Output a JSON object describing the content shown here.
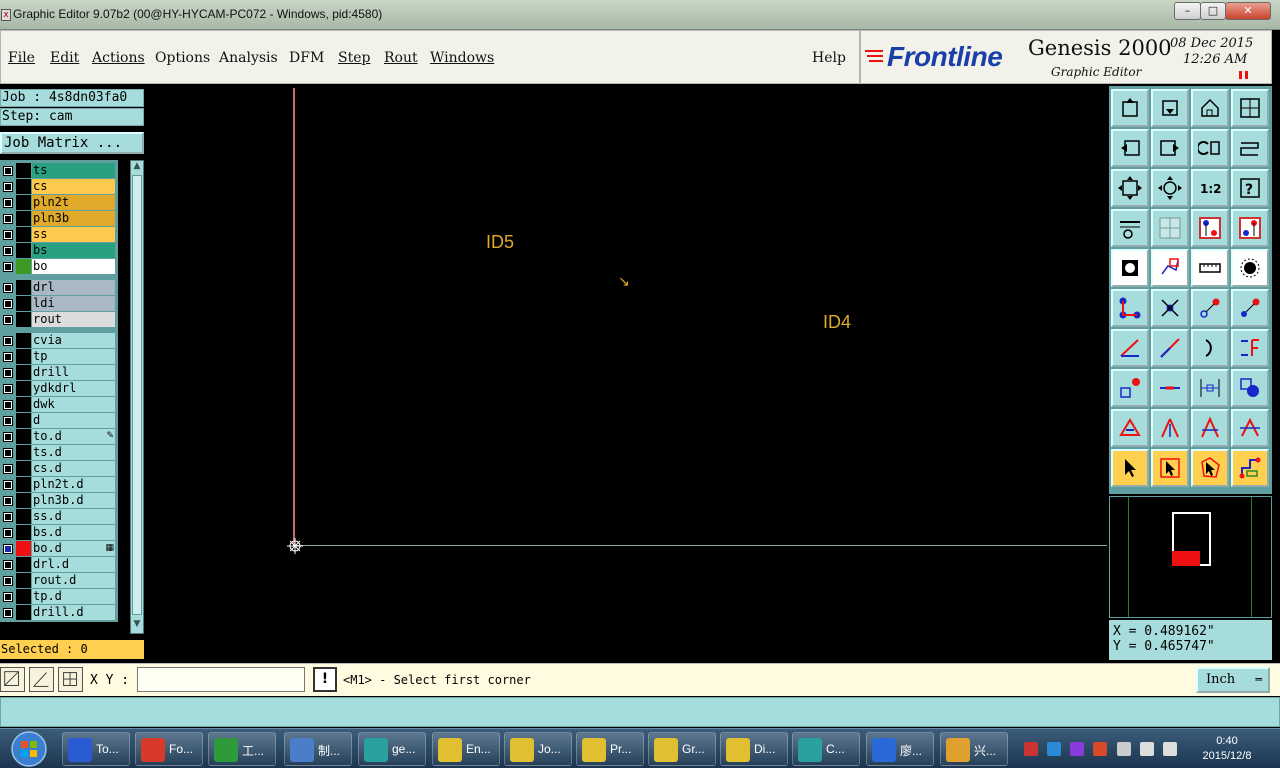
{
  "window": {
    "title": "Graphic Editor 9.07b2 (00@HY-HYCAM-PC072 - Windows, pid:4580)",
    "minimize": "–",
    "maximize": "□",
    "close": "✕"
  },
  "menu": {
    "items": [
      "File",
      "Edit",
      "Actions",
      "Options",
      "Analysis",
      "DFM",
      "Step",
      "Rout",
      "Windows"
    ],
    "help": "Help"
  },
  "brand": {
    "logo": "Frontline",
    "product": "Genesis 2000",
    "subtitle": "Graphic Editor",
    "date": "08 Dec 2015",
    "time": "12:26 AM"
  },
  "job": {
    "job_line": "Job : 4s8dn03fa0",
    "step_line": "Step: cam",
    "matrix_button": "Job Matrix ...",
    "selected": "Selected : 0"
  },
  "layers": {
    "group1": [
      {
        "name": "ts",
        "color": "#2aa083",
        "swatch": "#000000"
      },
      {
        "name": "cs",
        "color": "#ffc94d",
        "swatch": "#000000"
      },
      {
        "name": "pln2t",
        "color": "#e0a92a",
        "swatch": "#000000"
      },
      {
        "name": "pln3b",
        "color": "#e0a92a",
        "swatch": "#000000"
      },
      {
        "name": "ss",
        "color": "#ffc94d",
        "swatch": "#000000"
      },
      {
        "name": "bs",
        "color": "#2aa083",
        "swatch": "#000000"
      },
      {
        "name": "bo",
        "color": "#ffffff",
        "swatch": "#3c9a24"
      }
    ],
    "group2": [
      {
        "name": "drl",
        "color": "#a9b8c2",
        "swatch": "#000000"
      },
      {
        "name": "ldi",
        "color": "#a9b8c2",
        "swatch": "#000000"
      },
      {
        "name": "rout",
        "color": "#dcdcdc",
        "swatch": "#000000"
      }
    ],
    "group3": [
      {
        "name": "cvia",
        "color": "#a7dcdc",
        "swatch": "#000000",
        "mark": ""
      },
      {
        "name": "tp",
        "color": "#a7dcdc",
        "swatch": "#000000",
        "mark": ""
      },
      {
        "name": "drill",
        "color": "#a7dcdc",
        "swatch": "#000000",
        "mark": ""
      },
      {
        "name": "ydkdrl",
        "color": "#a7dcdc",
        "swatch": "#000000",
        "mark": ""
      },
      {
        "name": "dwk",
        "color": "#a7dcdc",
        "swatch": "#000000",
        "mark": ""
      },
      {
        "name": "d",
        "color": "#a7dcdc",
        "swatch": "#000000",
        "mark": ""
      },
      {
        "name": "to.d",
        "color": "#a7dcdc",
        "swatch": "#000000",
        "mark": "✎"
      },
      {
        "name": "ts.d",
        "color": "#a7dcdc",
        "swatch": "#000000",
        "mark": ""
      },
      {
        "name": "cs.d",
        "color": "#a7dcdc",
        "swatch": "#000000",
        "mark": ""
      },
      {
        "name": "pln2t.d",
        "color": "#a7dcdc",
        "swatch": "#000000",
        "mark": ""
      },
      {
        "name": "pln3b.d",
        "color": "#a7dcdc",
        "swatch": "#000000",
        "mark": ""
      },
      {
        "name": "ss.d",
        "color": "#a7dcdc",
        "swatch": "#000000",
        "mark": ""
      },
      {
        "name": "bs.d",
        "color": "#a7dcdc",
        "swatch": "#000000",
        "mark": ""
      },
      {
        "name": "bo.d",
        "color": "#a7dcdc",
        "swatch": "#ee1111",
        "mark": "▦",
        "selected": true
      },
      {
        "name": "drl.d",
        "color": "#a7dcdc",
        "swatch": "#000000",
        "mark": ""
      },
      {
        "name": "rout.d",
        "color": "#a7dcdc",
        "swatch": "#000000",
        "mark": ""
      },
      {
        "name": "tp.d",
        "color": "#a7dcdc",
        "swatch": "#000000",
        "mark": ""
      },
      {
        "name": "drill.d",
        "color": "#a7dcdc",
        "swatch": "#000000",
        "mark": ""
      }
    ]
  },
  "canvas": {
    "labels": [
      "ID5",
      "ID4"
    ],
    "cursor_glyph": "↘"
  },
  "tools": [
    "open-job-icon",
    "save-icon",
    "home-icon",
    "window-icon",
    "prev-step-icon",
    "next-step-icon",
    "undo-icon",
    "redo-icon",
    "zoom-fit-icon",
    "zoom-area-icon",
    "one-to-one-icon",
    "help-icon",
    "tool-settings-icon",
    "grid-icon",
    "snap-a-icon",
    "snap-b-icon",
    "fill-icon",
    "outline-icon",
    "ruler-icon",
    "pad-icon",
    "connect-icon",
    "delete-node-icon",
    "move-node-icon",
    "add-node-icon",
    "angle-line-icon",
    "line-icon",
    "arc-icon",
    "text-icon",
    "copy-feature-icon",
    "line-split-icon",
    "measure-icon",
    "transform-icon",
    "triangle-a-icon",
    "triangle-b-icon",
    "triangle-c-icon",
    "triangle-d-icon",
    "select-icon",
    "select-box-icon",
    "select-poly-icon",
    "route-icon"
  ],
  "coords": {
    "x": "X = 0.489162\"",
    "y": "Y = 0.465747\""
  },
  "command": {
    "xy_label": "X Y :",
    "xy_value": "",
    "excl": "!",
    "prompt": "<M1> - Select first corner",
    "unit": "Inch"
  },
  "taskbar": {
    "tasks": [
      {
        "label": "To...",
        "color": "#2a5bd0"
      },
      {
        "label": "Fo...",
        "color": "#d83a2a"
      },
      {
        "label": "工...",
        "color": "#2e9a3a"
      },
      {
        "label": "制...",
        "color": "#4a7ec8"
      },
      {
        "label": "ge...",
        "color": "#2aa0a0"
      },
      {
        "label": "En...",
        "color": "#e0c030"
      },
      {
        "label": "Jo...",
        "color": "#e0c030"
      },
      {
        "label": "Pr...",
        "color": "#e0c030"
      },
      {
        "label": "Gr...",
        "color": "#e0c030"
      },
      {
        "label": "Di...",
        "color": "#e0c030"
      },
      {
        "label": "C...",
        "color": "#2aa0a0"
      },
      {
        "label": "廖...",
        "color": "#2a6ad8"
      },
      {
        "label": "兴...",
        "color": "#e0a030"
      }
    ],
    "time": "0:40",
    "date": "2015/12/8"
  }
}
